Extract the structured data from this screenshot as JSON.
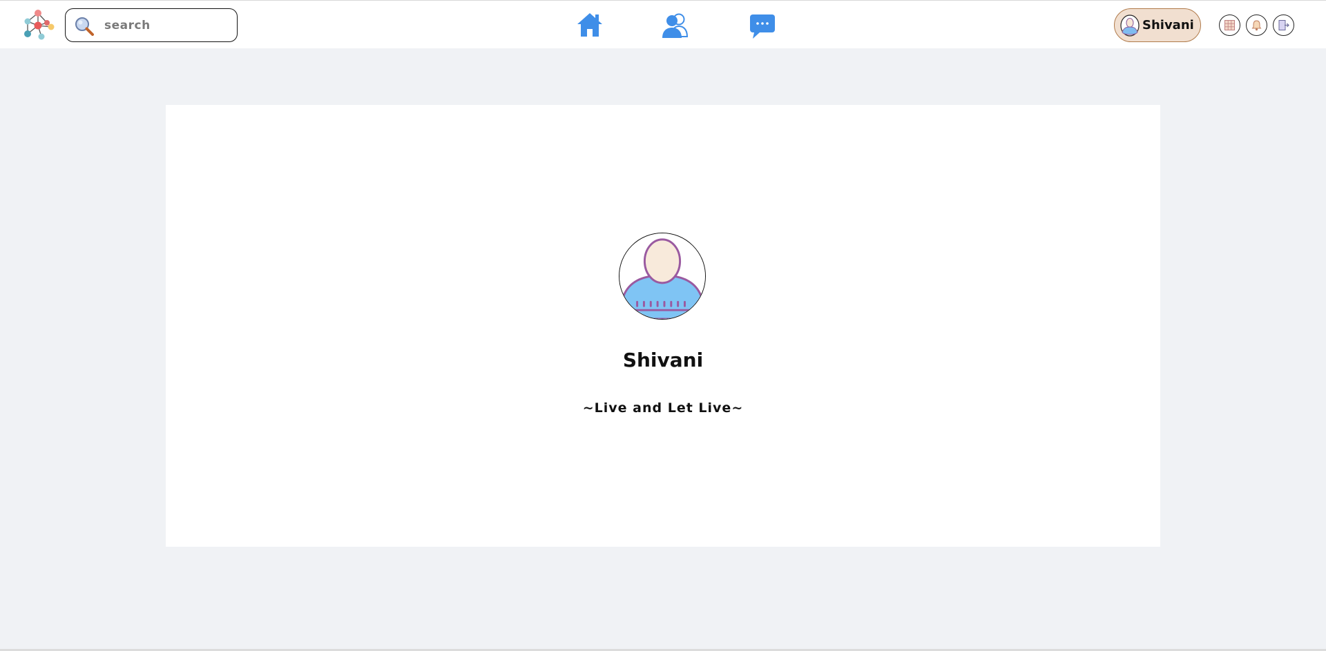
{
  "header": {
    "logo_icon": "network-logo-icon",
    "search": {
      "placeholder": "search",
      "value": "",
      "icon": "search-magnifier-icon"
    },
    "nav": [
      {
        "name": "home",
        "icon": "home-icon",
        "color": "#3f8ee8"
      },
      {
        "name": "friends",
        "icon": "users-icon",
        "color": "#3f8ee8"
      },
      {
        "name": "messages",
        "icon": "chat-bubble-icon",
        "color": "#3f8ee8"
      }
    ],
    "user_pill": {
      "name": "Shivani",
      "background": "#f1dfd0",
      "border": "#b07a4a"
    },
    "actions": [
      {
        "name": "apps",
        "icon": "grid-icon"
      },
      {
        "name": "notifications",
        "icon": "bell-icon"
      },
      {
        "name": "logout",
        "icon": "logout-icon"
      }
    ]
  },
  "profile": {
    "name": "Shivani",
    "bio": "~Live and Let Live~",
    "avatar_icon": "user-avatar-icon"
  },
  "colors": {
    "page_background": "#f0f2f5",
    "card_background": "#ffffff",
    "accent": "#3f8ee8"
  }
}
